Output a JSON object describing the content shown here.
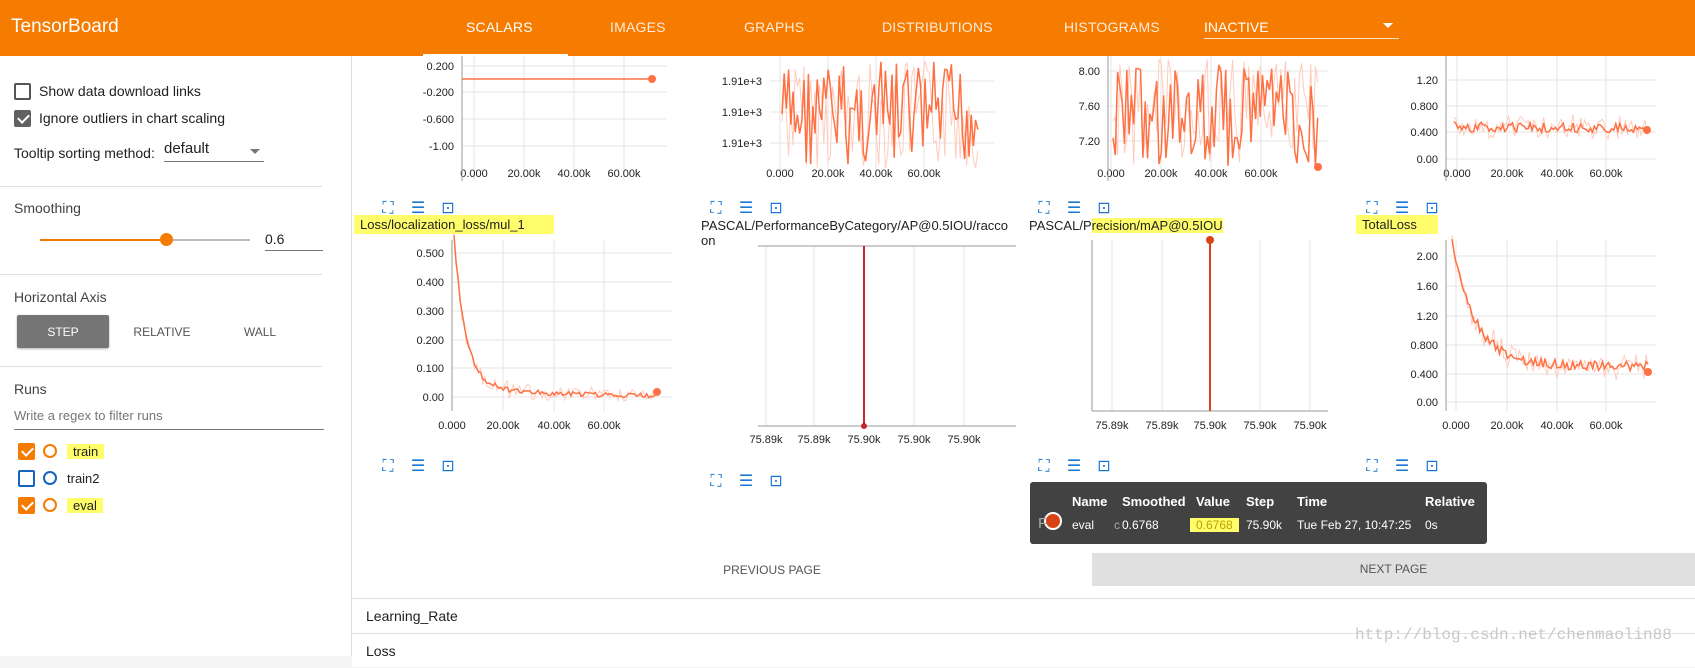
{
  "header": {
    "brand": "TensorBoard",
    "tabs": [
      {
        "label": "SCALARS",
        "active": true
      },
      {
        "label": "IMAGES"
      },
      {
        "label": "GRAPHS"
      },
      {
        "label": "DISTRIBUTIONS"
      },
      {
        "label": "HISTOGRAMS"
      }
    ],
    "inactive_label": "INACTIVE"
  },
  "sidebar": {
    "show_download": "Show data download links",
    "ignore_outliers": "Ignore outliers in chart scaling",
    "tooltip_sort_label": "Tooltip sorting method:",
    "tooltip_sort_value": "default",
    "smoothing_title": "Smoothing",
    "smoothing_value": "0.6",
    "smoothing_fraction": 0.6,
    "haxis_title": "Horizontal Axis",
    "haxis_step": "STEP",
    "haxis_relative": "RELATIVE",
    "haxis_wall": "WALL",
    "runs_title": "Runs",
    "runs_filter_placeholder": "Write a regex to filter runs",
    "runs": [
      {
        "name": "train",
        "checked": true,
        "color": "#f57c00"
      },
      {
        "name": "train2",
        "checked": false,
        "color": "#1565c0"
      },
      {
        "name": "eval",
        "checked": true,
        "color": "#f57c00"
      }
    ]
  },
  "charts": {
    "row1": [
      {
        "yticks": [
          "0.200",
          "-0.200",
          "-0.600",
          "-1.00"
        ],
        "xticks": [
          "0.000",
          "20.00k",
          "40.00k",
          "60.00k"
        ]
      },
      {
        "yticks": [
          "1.91e+3",
          "1.91e+3",
          "1.91e+3"
        ],
        "xticks": [
          "0.000",
          "20.00k",
          "40.00k",
          "60.00k"
        ]
      },
      {
        "yticks": [
          "8.00",
          "7.60",
          "7.20"
        ],
        "xticks": [
          "0.000",
          "20.00k",
          "40.00k",
          "60.00k"
        ]
      },
      {
        "yticks": [
          "1.20",
          "0.800",
          "0.400",
          "0.00"
        ],
        "xticks": [
          "0.000",
          "20.00k",
          "40.00k",
          "60.00k"
        ]
      }
    ],
    "row2": [
      {
        "title": "Loss/localization_loss/mul_1",
        "yticks": [
          "0.500",
          "0.400",
          "0.300",
          "0.200",
          "0.100",
          "0.00"
        ],
        "xticks": [
          "0.000",
          "20.00k",
          "40.00k",
          "60.00k"
        ]
      },
      {
        "title_line1": "PASCAL/PerformanceByCategory/AP@0.5IOU/racco",
        "title_line2": "on",
        "xticks": [
          "75.89k",
          "75.89k",
          "75.90k",
          "75.90k",
          "75.90k"
        ]
      },
      {
        "title_a": "PASCAL/P",
        "title_b": "recision/mAP@0.5IOU",
        "xticks": [
          "75.89k",
          "75.89k",
          "75.90k",
          "75.90k",
          "75.90k"
        ]
      },
      {
        "title": "TotalLoss",
        "yticks": [
          "2.00",
          "1.60",
          "1.20",
          "0.800",
          "0.400",
          "0.00"
        ],
        "xticks": [
          "0.000",
          "20.00k",
          "40.00k",
          "60.00k"
        ]
      }
    ]
  },
  "tooltip": {
    "headers": {
      "name": "Name",
      "smoothed": "Smoothed",
      "value": "Value",
      "step": "Step",
      "time": "Time",
      "relative": "Relative"
    },
    "row": {
      "name": "eval",
      "smoothed": "0.6768",
      "value": "0.6768",
      "step": "75.90k",
      "time": "Tue Feb 27, 10:47:25",
      "relative": "0s"
    },
    "peek_a": "F",
    "peek_b": "c"
  },
  "pager": {
    "prev": "PREVIOUS PAGE",
    "next": "NEXT PAGE"
  },
  "categories": [
    "Learning_Rate",
    "Loss"
  ],
  "watermark": "http://blog.csdn.net/chenmaolin88",
  "colors": {
    "accent": "#f57c00",
    "line": "#ff7043",
    "line_light": "#ffccbc",
    "eval": "#d84315",
    "icon": "#1976d2"
  }
}
